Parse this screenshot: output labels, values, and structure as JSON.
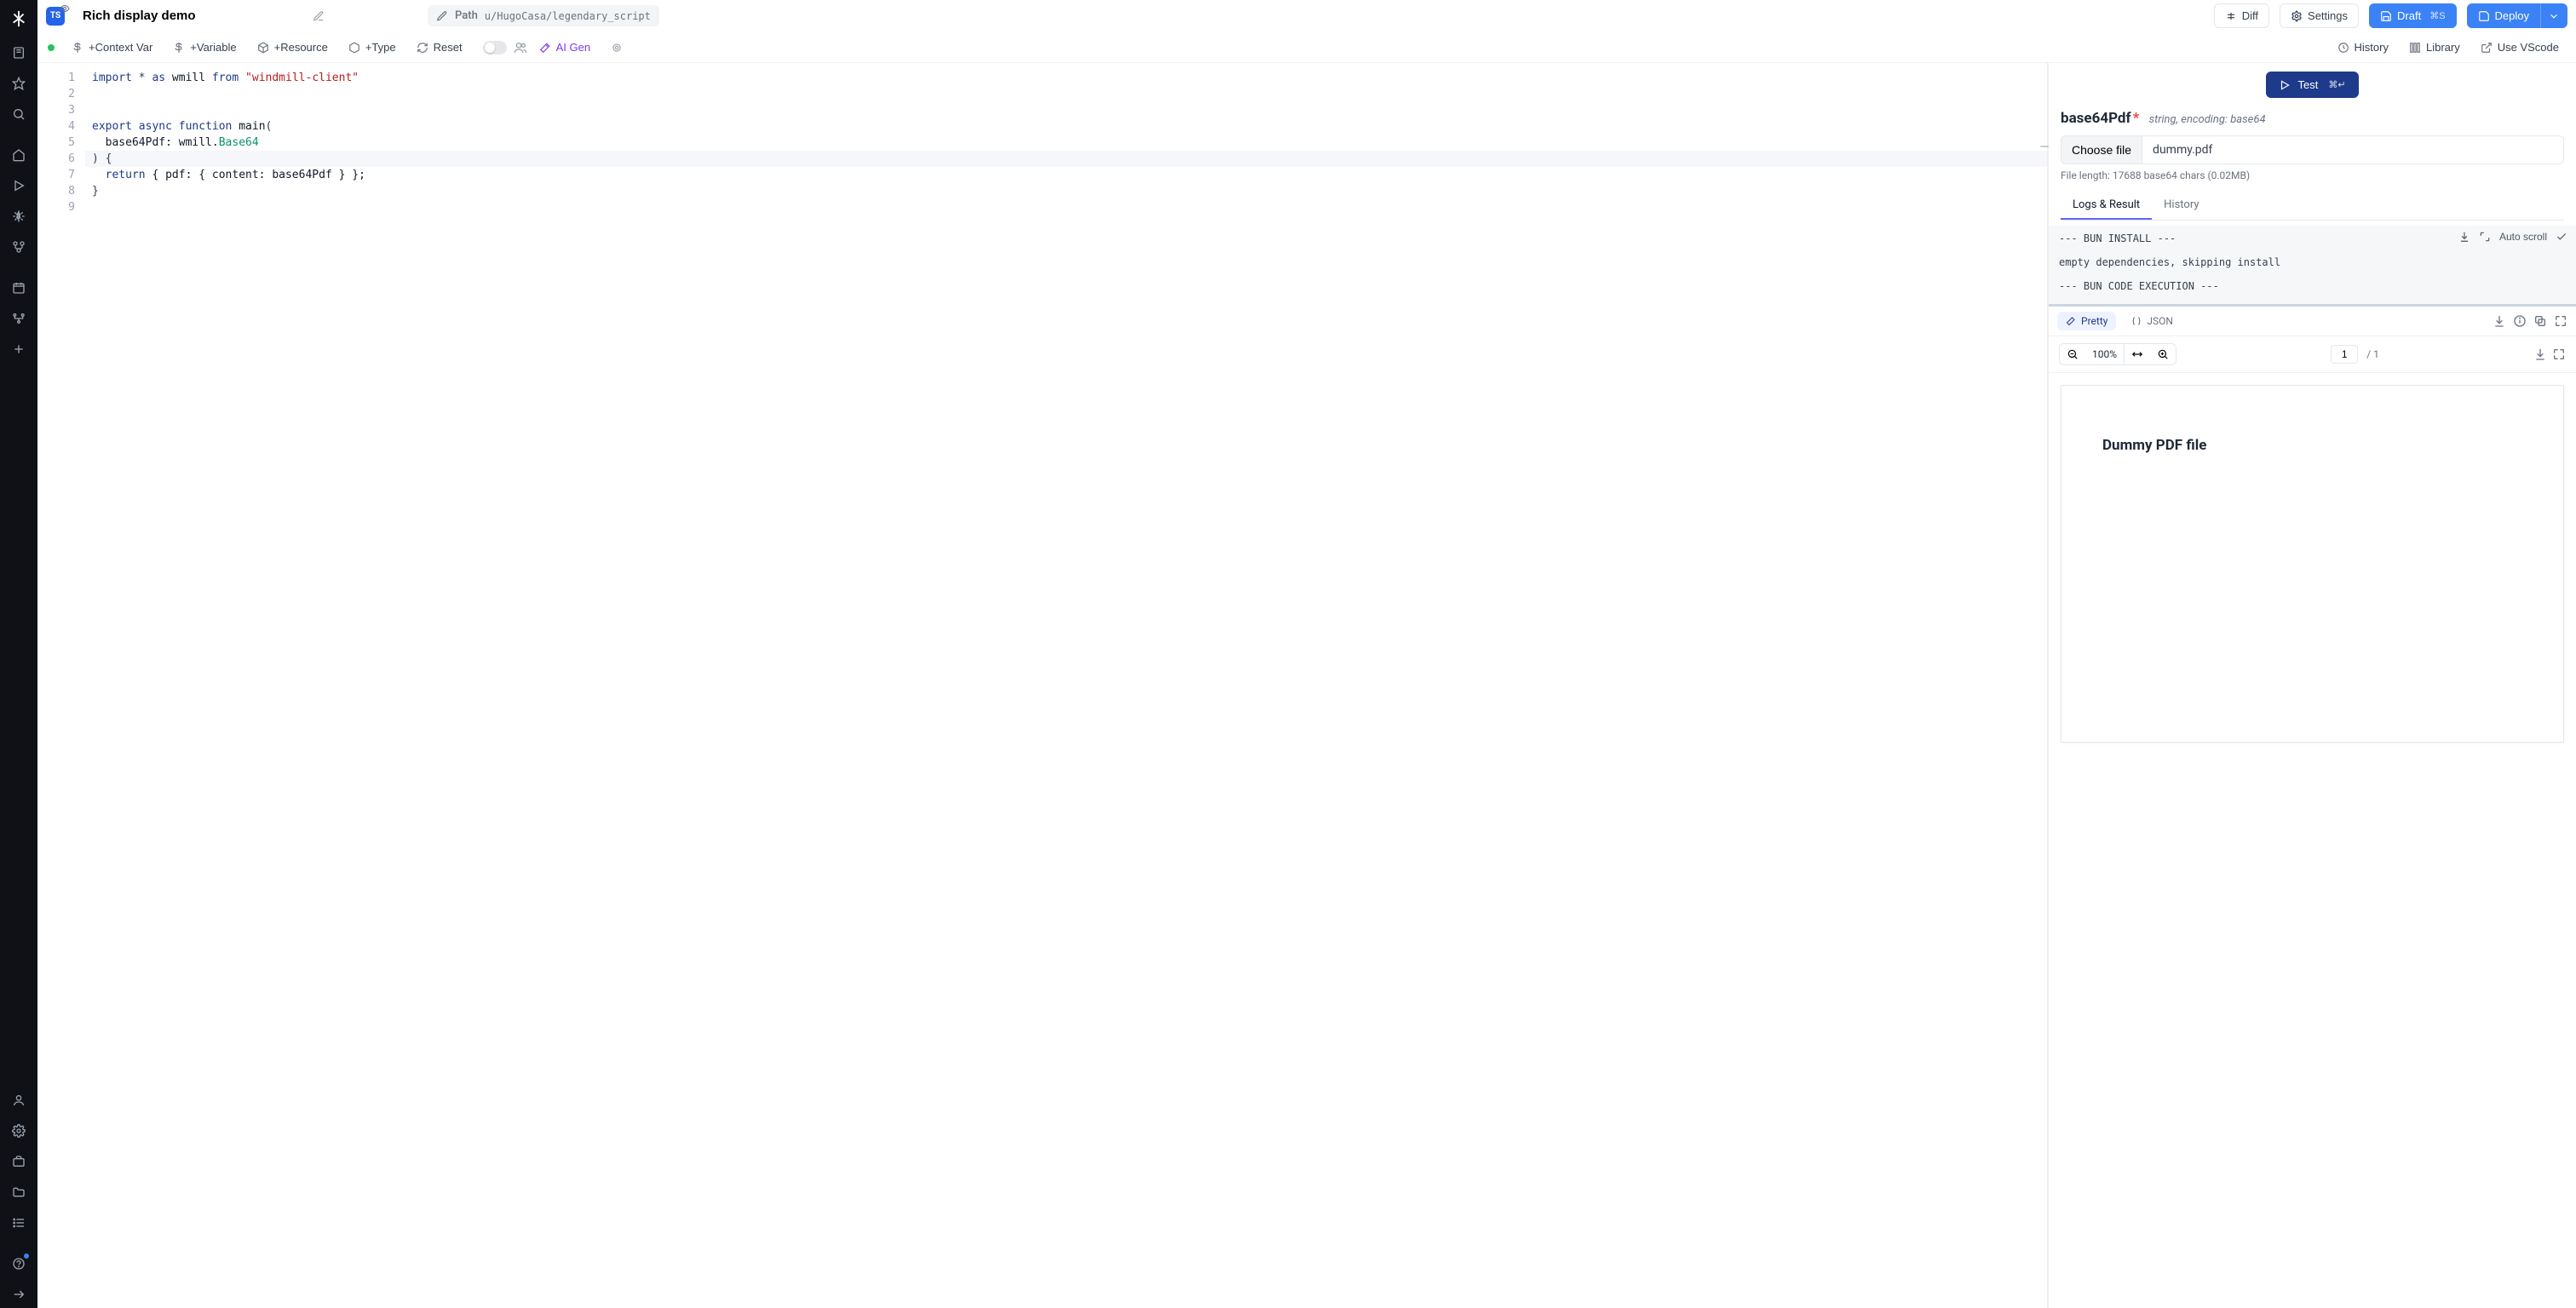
{
  "header": {
    "title": "Rich display demo",
    "path_label": "Path",
    "path_value": "u/HugoCasa/legendary_script",
    "diff": "Diff",
    "settings": "Settings",
    "draft": "Draft",
    "draft_kbd": "⌘S",
    "deploy": "Deploy"
  },
  "toolbar": {
    "context_var": "+Context Var",
    "variable": "+Variable",
    "resource": "+Resource",
    "type": "+Type",
    "reset": "Reset",
    "ai_gen": "AI Gen",
    "history": "History",
    "library": "Library",
    "use_vscode": "Use VScode"
  },
  "editor": {
    "line_numbers": [
      "1",
      "2",
      "3",
      "4",
      "5",
      "6",
      "7",
      "8",
      "9"
    ],
    "lines": [
      {
        "tokens": [
          {
            "t": "import",
            "c": "tok-kw"
          },
          {
            "t": " * ",
            "c": "tok-punc"
          },
          {
            "t": "as",
            "c": "tok-kw"
          },
          {
            "t": " wmill ",
            "c": "tok-ident"
          },
          {
            "t": "from",
            "c": "tok-kw"
          },
          {
            "t": " ",
            "c": ""
          },
          {
            "t": "\"windmill-client\"",
            "c": "tok-str"
          }
        ]
      },
      {
        "tokens": []
      },
      {
        "tokens": []
      },
      {
        "tokens": [
          {
            "t": "export",
            "c": "tok-kw"
          },
          {
            "t": " ",
            "c": ""
          },
          {
            "t": "async",
            "c": "tok-kw"
          },
          {
            "t": " ",
            "c": ""
          },
          {
            "t": "function",
            "c": "tok-kw"
          },
          {
            "t": " main",
            "c": "tok-ident"
          },
          {
            "t": "(",
            "c": "tok-punc"
          }
        ]
      },
      {
        "tokens": [
          {
            "t": "  base64Pdf: wmill.",
            "c": "tok-ident"
          },
          {
            "t": "Base64",
            "c": "tok-type"
          }
        ]
      },
      {
        "tokens": [
          {
            "t": ") {",
            "c": "tok-punc"
          }
        ],
        "hl": true
      },
      {
        "tokens": [
          {
            "t": "  ",
            "c": ""
          },
          {
            "t": "return",
            "c": "tok-kw"
          },
          {
            "t": " { pdf: { content: base64Pdf } };",
            "c": "tok-ident"
          }
        ]
      },
      {
        "tokens": [
          {
            "t": "}",
            "c": "tok-punc"
          }
        ]
      },
      {
        "tokens": []
      }
    ]
  },
  "panel": {
    "test": "Test",
    "test_kbd": "⌘↵",
    "param_name": "base64Pdf",
    "param_type": "string, encoding: base64",
    "choose_file": "Choose file",
    "file_name": "dummy.pdf",
    "file_meta": "File length: 17688 base64 chars (0.02MB)",
    "tab_logs": "Logs & Result",
    "tab_history": "History",
    "logs_autoscroll": "Auto scroll",
    "logs_text": "--- BUN INSTALL ---\n\nempty dependencies, skipping install\n\n--- BUN CODE EXECUTION ---",
    "chip_pretty": "Pretty",
    "chip_json": "JSON",
    "zoom": "100%",
    "page_current": "1",
    "page_total": "/ 1",
    "pdf_heading": "Dummy PDF file"
  }
}
